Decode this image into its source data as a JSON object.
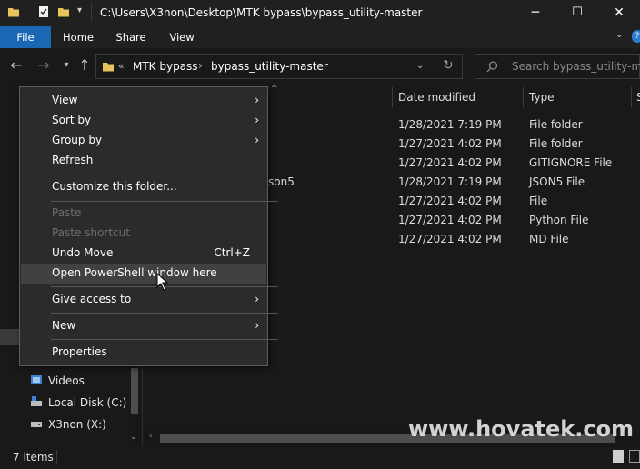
{
  "window": {
    "title": "C:\\Users\\X3non\\Desktop\\MTK bypass\\bypass_utility-master",
    "controls": {
      "minimize": "─",
      "maximize": "☐",
      "close": "✕"
    }
  },
  "ribbon": {
    "tabs": [
      {
        "label": "File",
        "active": true
      },
      {
        "label": "Home"
      },
      {
        "label": "Share"
      },
      {
        "label": "View"
      }
    ],
    "accent": "#1a67b4"
  },
  "address": {
    "overflow": "«",
    "crumbs": [
      "MTK bypass",
      "bypass_utility-master"
    ],
    "separator": "›",
    "search_placeholder": "Search bypass_utility-ma..."
  },
  "columns": [
    "Date modified",
    "Type",
    "S"
  ],
  "files": [
    {
      "name_fragment": "",
      "date": "1/28/2021 7:19 PM",
      "type": "File folder"
    },
    {
      "name_fragment": "",
      "date": "1/27/2021 4:02 PM",
      "type": "File folder"
    },
    {
      "name_fragment": "",
      "date": "1/27/2021 4:02 PM",
      "type": "GITIGNORE File"
    },
    {
      "name_fragment": "son5",
      "date": "1/28/2021 7:19 PM",
      "type": "JSON5 File"
    },
    {
      "name_fragment": "",
      "date": "1/27/2021 4:02 PM",
      "type": "File"
    },
    {
      "name_fragment": "",
      "date": "1/27/2021 4:02 PM",
      "type": "Python File"
    },
    {
      "name_fragment": "",
      "date": "1/27/2021 4:02 PM",
      "type": "MD File"
    }
  ],
  "nav_pane": [
    {
      "label": "Videos",
      "icon": "videos-icon"
    },
    {
      "label": "Local Disk (C:)",
      "icon": "local-disk-icon"
    },
    {
      "label": "X3non (X:)",
      "icon": "drive-icon"
    }
  ],
  "status": {
    "item_count": "7 items"
  },
  "context_menu": {
    "items": [
      {
        "label": "View",
        "submenu": true
      },
      {
        "label": "Sort by",
        "submenu": true
      },
      {
        "label": "Group by",
        "submenu": true
      },
      {
        "label": "Refresh"
      },
      {
        "label": "Customize this folder..."
      },
      {
        "label": "Paste",
        "disabled": true
      },
      {
        "label": "Paste shortcut",
        "disabled": true
      },
      {
        "label": "Undo Move",
        "shortcut": "Ctrl+Z"
      },
      {
        "label": "Open PowerShell window here",
        "highlighted": true
      },
      {
        "label": "Give access to",
        "submenu": true
      },
      {
        "label": "New",
        "submenu": true
      },
      {
        "label": "Properties"
      }
    ],
    "submenu_arrow": "›"
  },
  "watermark": "www.hovatek.com"
}
